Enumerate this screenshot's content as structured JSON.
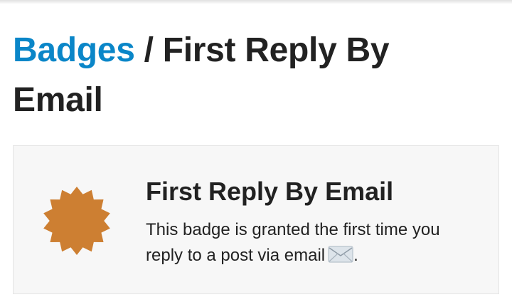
{
  "breadcrumb": {
    "link_label": "Badges",
    "separator": " / ",
    "current": "First Reply By Email"
  },
  "badge": {
    "name": "First Reply By Email",
    "description": "This badge is granted the first time you reply to a post via email",
    "description_end": ".",
    "emoji": "envelope-icon",
    "icon": "badge-starburst-icon",
    "color": "#cd7f32"
  },
  "colors": {
    "link": "#0a86c8",
    "card_bg": "#f7f7f7",
    "text": "#222222"
  }
}
